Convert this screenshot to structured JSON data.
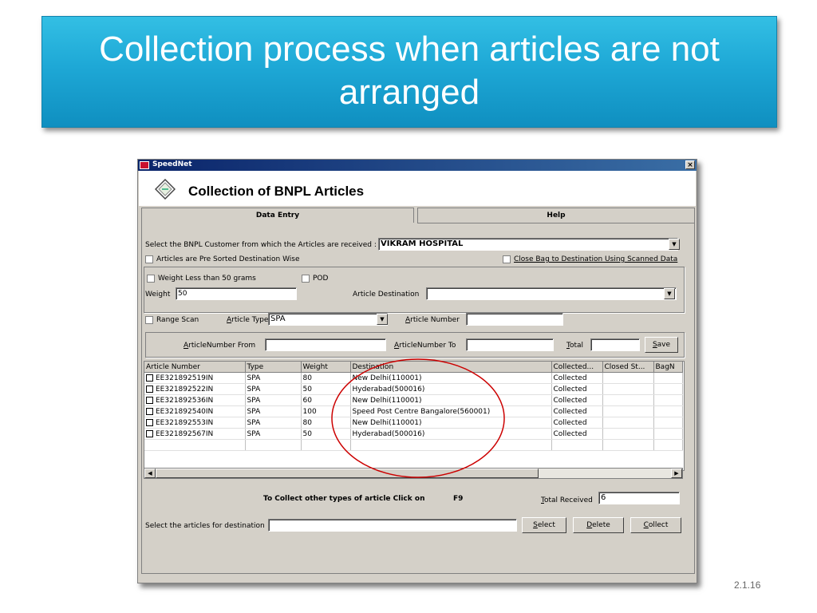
{
  "slide": {
    "title": "Collection process when articles are not arranged",
    "slide_number": "2.1.16"
  },
  "window": {
    "app_title": "SpeedNet",
    "close_glyph": "×",
    "header_title": "Collection of BNPL Articles",
    "tabs": [
      {
        "label": "Data Entry"
      },
      {
        "label": "Help"
      }
    ]
  },
  "form": {
    "customer_label": "Select the BNPL Customer from which the Articles are received :",
    "customer_value": "VIKRAM HOSPITAL",
    "presorted_label": "Articles are Pre Sorted Destination Wise",
    "close_bag_label": "Close Bag to Destination Using Scanned Data",
    "weight_less_label": "Weight Less than 50 grams",
    "pod_label": "POD",
    "weight_label": "Weight",
    "weight_value": "50",
    "article_destination_label": "Article Destination",
    "article_destination_value": "",
    "range_scan_label": "Range Scan",
    "article_type_label_first": "A",
    "article_type_label_rest": "rticle Type",
    "article_type_value": "SPA",
    "article_number_label_first": "A",
    "article_number_label_rest": "rticle Number",
    "article_number_value": "",
    "from_label_first": "A",
    "from_label_rest": "rticleNumber From",
    "from_value": "",
    "to_label_first": "A",
    "to_label_rest": "rticleNumber To",
    "to_value": "",
    "total_label_first": "T",
    "total_label_rest": "otal",
    "total_value": "",
    "save_first": "S",
    "save_rest": "ave"
  },
  "grid": {
    "columns": [
      "Article Number",
      "Type",
      "Weight",
      "Destination",
      "Collected...",
      "Closed St...",
      "BagN"
    ],
    "rows": [
      {
        "article_number": "EE321892519IN",
        "type": "SPA",
        "weight": "80",
        "destination": "New Delhi(110001)",
        "collected": "Collected",
        "closed": "",
        "bag": ""
      },
      {
        "article_number": "EE321892522IN",
        "type": "SPA",
        "weight": "50",
        "destination": "Hyderabad(500016)",
        "collected": "Collected",
        "closed": "",
        "bag": ""
      },
      {
        "article_number": "EE321892536IN",
        "type": "SPA",
        "weight": "60",
        "destination": "New Delhi(110001)",
        "collected": "Collected",
        "closed": "",
        "bag": ""
      },
      {
        "article_number": "EE321892540IN",
        "type": "SPA",
        "weight": "100",
        "destination": "Speed Post Centre Bangalore(560001)",
        "collected": "Collected",
        "closed": "",
        "bag": ""
      },
      {
        "article_number": "EE321892553IN",
        "type": "SPA",
        "weight": "80",
        "destination": "New Delhi(110001)",
        "collected": "Collected",
        "closed": "",
        "bag": ""
      },
      {
        "article_number": "EE321892567IN",
        "type": "SPA",
        "weight": "50",
        "destination": "Hyderabad(500016)",
        "collected": "Collected",
        "closed": "",
        "bag": ""
      }
    ]
  },
  "footer": {
    "collect_other_label": "To Collect other types of article Click on",
    "f9_label": "F9",
    "total_received_first": "T",
    "total_received_rest": "otal Received",
    "total_received_value": "6",
    "select_dest_label": "Select the articles for destination",
    "select_dest_value": "",
    "select_first": "S",
    "select_rest": "elect",
    "delete_first": "D",
    "delete_rest": "elete",
    "collect_first": "C",
    "collect_rest": "ollect"
  },
  "colors": {
    "banner": "#1ea8d6",
    "annotation": "#cc0000",
    "window_face": "#d4d0c8"
  }
}
